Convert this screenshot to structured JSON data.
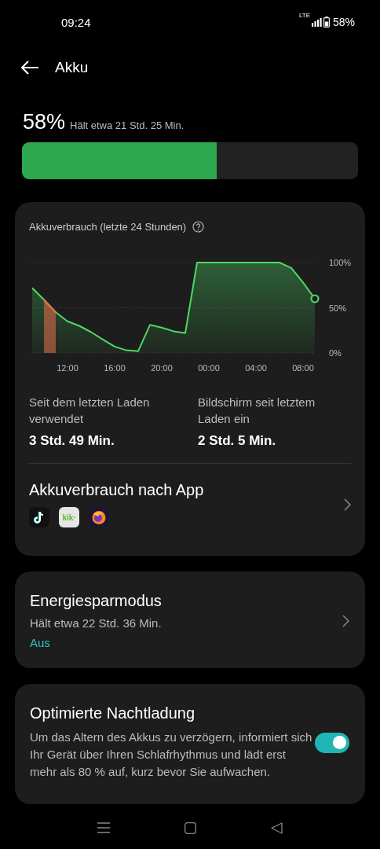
{
  "status_bar": {
    "time": "09:24",
    "network": "LTE",
    "battery": "58%"
  },
  "header": {
    "title": "Akku"
  },
  "battery": {
    "percent": "58%",
    "estimate": "Hält etwa 21 Std. 25 Min.",
    "level": 0.58
  },
  "usage_card": {
    "title": "Akkuverbrauch (letzte 24 Stunden)",
    "chart_data": {
      "type": "area",
      "categories": [
        null,
        null,
        null,
        "12:00",
        null,
        null,
        null,
        "16:00",
        null,
        null,
        null,
        "20:00",
        null,
        null,
        null,
        "00:00",
        null,
        null,
        null,
        "04:00",
        null,
        null,
        null,
        "08:00",
        null
      ],
      "series": [
        {
          "color": "#4cd964",
          "values": [
            72,
            59,
            45,
            35,
            30,
            23,
            15,
            7,
            3,
            2,
            31,
            28,
            24,
            22,
            100,
            100,
            100,
            100,
            100,
            100,
            100,
            100,
            94,
            78,
            60
          ]
        },
        {
          "color": "#e8704a",
          "values": [
            null,
            59,
            45,
            null,
            null,
            null,
            null,
            null,
            null,
            null,
            null,
            null,
            null,
            null,
            null,
            null,
            null,
            null,
            null,
            null,
            null,
            null,
            null,
            null,
            null
          ]
        }
      ],
      "ylim": [
        0,
        100
      ],
      "yticks": [
        {
          "value": 100,
          "label": "100%"
        },
        {
          "value": 50,
          "label": "50%"
        },
        {
          "value": 0,
          "label": "0%"
        }
      ]
    },
    "stats": [
      {
        "label": "Seit dem letzten Laden verwendet",
        "value": "3 Std. 49 Min."
      },
      {
        "label": "Bildschirm seit letztem Laden ein",
        "value": "2 Std. 5 Min."
      }
    ],
    "apps_title": "Akkuverbrauch nach App",
    "kik_label": "kik·"
  },
  "power_saving": {
    "title": "Energiesparmodus",
    "subtitle": "Hält etwa 22 Std. 36 Min.",
    "status": "Aus"
  },
  "night_charging": {
    "title": "Optimierte Nachtladung",
    "description": "Um das Altern des Akkus zu verzögern, informiert sich Ihr Gerät über Ihren Schlafrhythmus und lädt erst mehr als 80 % auf, kurz bevor Sie aufwachen.",
    "on": true
  }
}
